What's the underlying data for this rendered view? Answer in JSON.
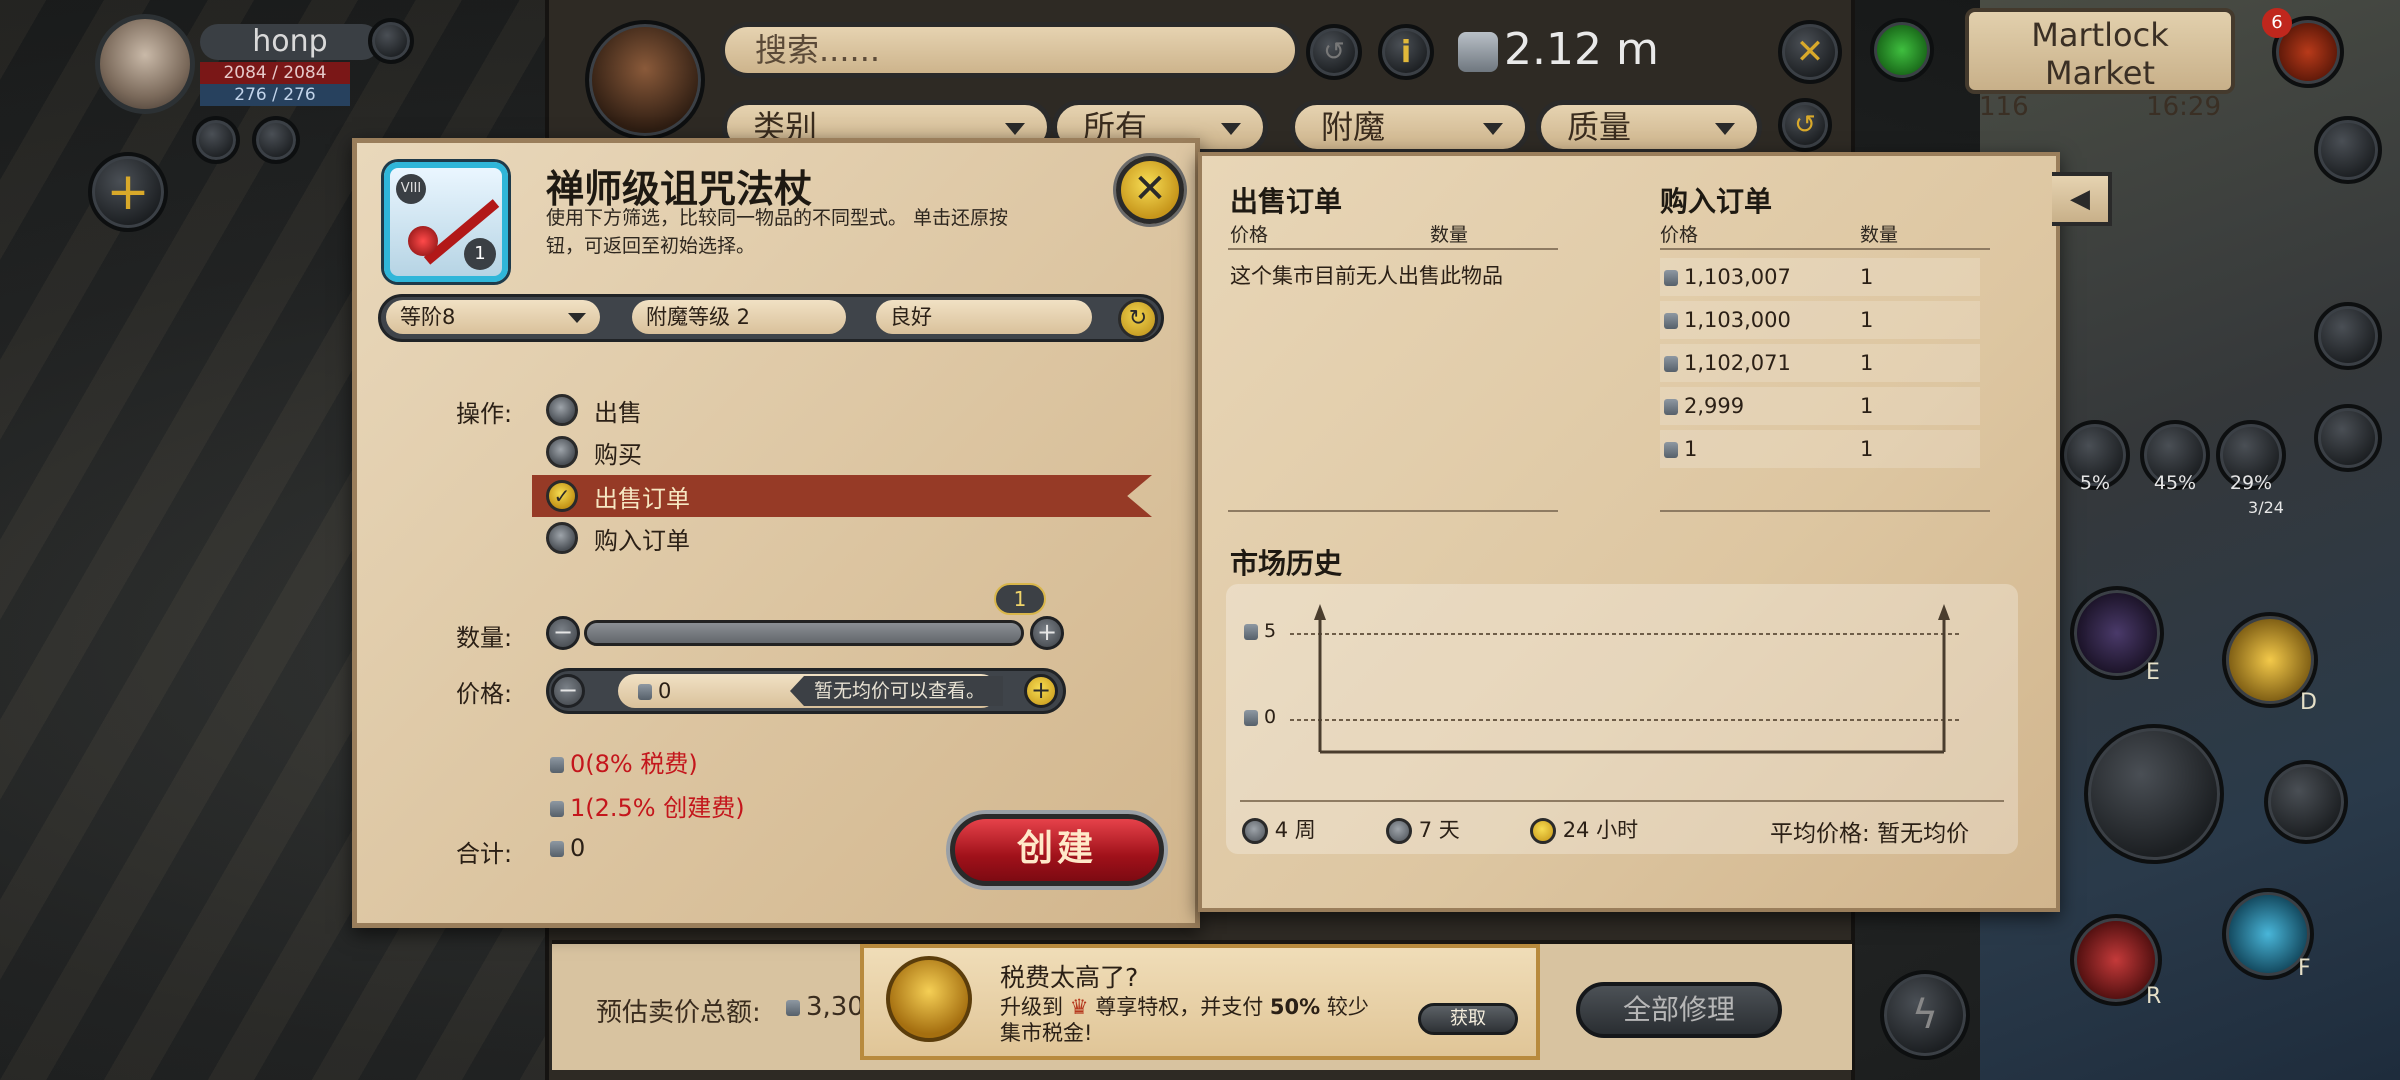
{
  "player": {
    "name": "honp",
    "hp": "2084 / 2084",
    "mp": "276 / 276"
  },
  "topbar": {
    "search_placeholder": "搜索......",
    "silver": "2.12 m",
    "filters": [
      "类别",
      "所有",
      "附魔",
      "质量"
    ]
  },
  "location": {
    "name": "Martlock Market",
    "count": "116",
    "time": "16:29",
    "notification_badge": "6"
  },
  "item": {
    "title": "禅师级诅咒法杖",
    "tier_badge": "VIII",
    "quantity_badge": "1",
    "description": "使用下方筛选，比较同一物品的不同型式。 单击还原按钮，可返回至初始选择。",
    "tier_select": "等阶8",
    "enchant_select": "附魔等级 2",
    "quality_select": "良好"
  },
  "form": {
    "operation_label": "操作:",
    "operations": [
      {
        "label": "出售",
        "selected": false
      },
      {
        "label": "购买",
        "selected": false
      },
      {
        "label": "出售订单",
        "selected": true
      },
      {
        "label": "购入订单",
        "selected": false
      }
    ],
    "quantity_label": "数量:",
    "quantity_value": "1",
    "quantity_fraction": 1.0,
    "price_label": "价格:",
    "price_value": "0",
    "price_hint": "暂无均价可以查看。",
    "tax_fee": "0(8% 税费)",
    "setup_fee": "1(2.5% 创建费)",
    "total_label": "合计:",
    "total_value": "0",
    "create_button": "创建"
  },
  "market": {
    "sell_orders": {
      "title": "出售订单",
      "col_price": "价格",
      "col_qty": "数量",
      "empty_text": "这个集市目前无人出售此物品"
    },
    "buy_orders": {
      "title": "购入订单",
      "col_price": "价格",
      "col_qty": "数量",
      "rows": [
        {
          "price": "1,103,007",
          "qty": "1"
        },
        {
          "price": "1,103,000",
          "qty": "1"
        },
        {
          "price": "1,102,071",
          "qty": "1"
        },
        {
          "price": "2,999",
          "qty": "1"
        },
        {
          "price": "1",
          "qty": "1"
        }
      ]
    },
    "history": {
      "title": "市场历史",
      "y_ticks": [
        "5",
        "0"
      ],
      "ranges": [
        {
          "label": "4 周",
          "selected": false
        },
        {
          "label": "7 天",
          "selected": false
        },
        {
          "label": "24 小时",
          "selected": true
        }
      ],
      "avg_label": "平均价格:",
      "avg_value": "暂无均价"
    }
  },
  "bottom": {
    "estimate_label": "预估卖价总额:",
    "estimate_value": "3,30",
    "repair_button": "全部修理",
    "promo_title": "税费太高了?",
    "promo_text_1": "升级到",
    "promo_text_2": "尊享特权，并支付",
    "promo_bold": "50%",
    "promo_text_3": "较少",
    "promo_text_4": "集市税金!",
    "promo_button": "获取"
  },
  "hud": {
    "percents": [
      "5%",
      "45%",
      "29%"
    ],
    "count": "3/24",
    "keys": [
      "E",
      "D",
      "R",
      "F"
    ]
  },
  "colors": {
    "accent_red": "#963a26",
    "parchment": "#e9d8bb",
    "fee_red": "#c4161c",
    "gold": "#f6dc52"
  }
}
